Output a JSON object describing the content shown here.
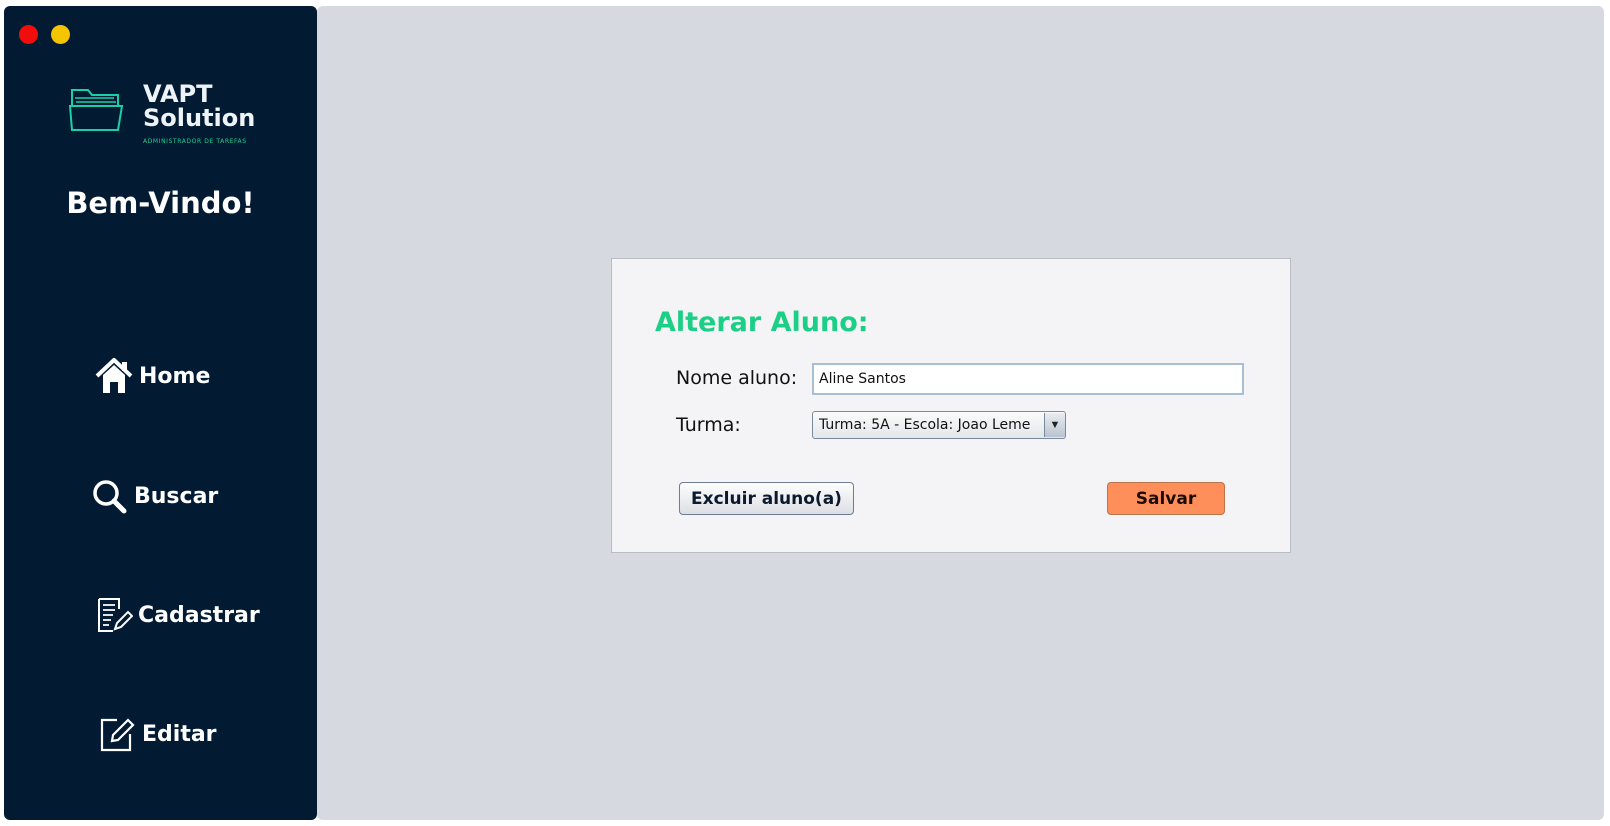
{
  "window": {
    "controls": [
      "close",
      "minimize"
    ],
    "colors": {
      "close": "#f20d0d",
      "minimize": "#f5c400"
    }
  },
  "sidebar": {
    "logo": {
      "line1": "VAPT",
      "line2": "Solution",
      "tagline": "ADMINISTRADOR DE TAREFAS",
      "icon": "folder-icon"
    },
    "welcome": "Bem-Vindo!",
    "items": [
      {
        "label": "Home",
        "icon": "home-icon"
      },
      {
        "label": "Buscar",
        "icon": "search-icon"
      },
      {
        "label": "Cadastrar",
        "icon": "document-edit-icon"
      },
      {
        "label": "Editar",
        "icon": "edit-icon"
      }
    ],
    "background": "#021b33"
  },
  "form": {
    "title": "Alterar Aluno:",
    "nome_label": "Nome aluno:",
    "nome_value": "Aline Santos",
    "turma_label": "Turma:",
    "turma_selected": "Turma: 5A - Escola: Joao Leme",
    "excluir_label": "Excluir aluno(a)",
    "salvar_label": "Salvar",
    "colors": {
      "title": "#1bcf86",
      "salvar": "#ff8f5a"
    }
  }
}
